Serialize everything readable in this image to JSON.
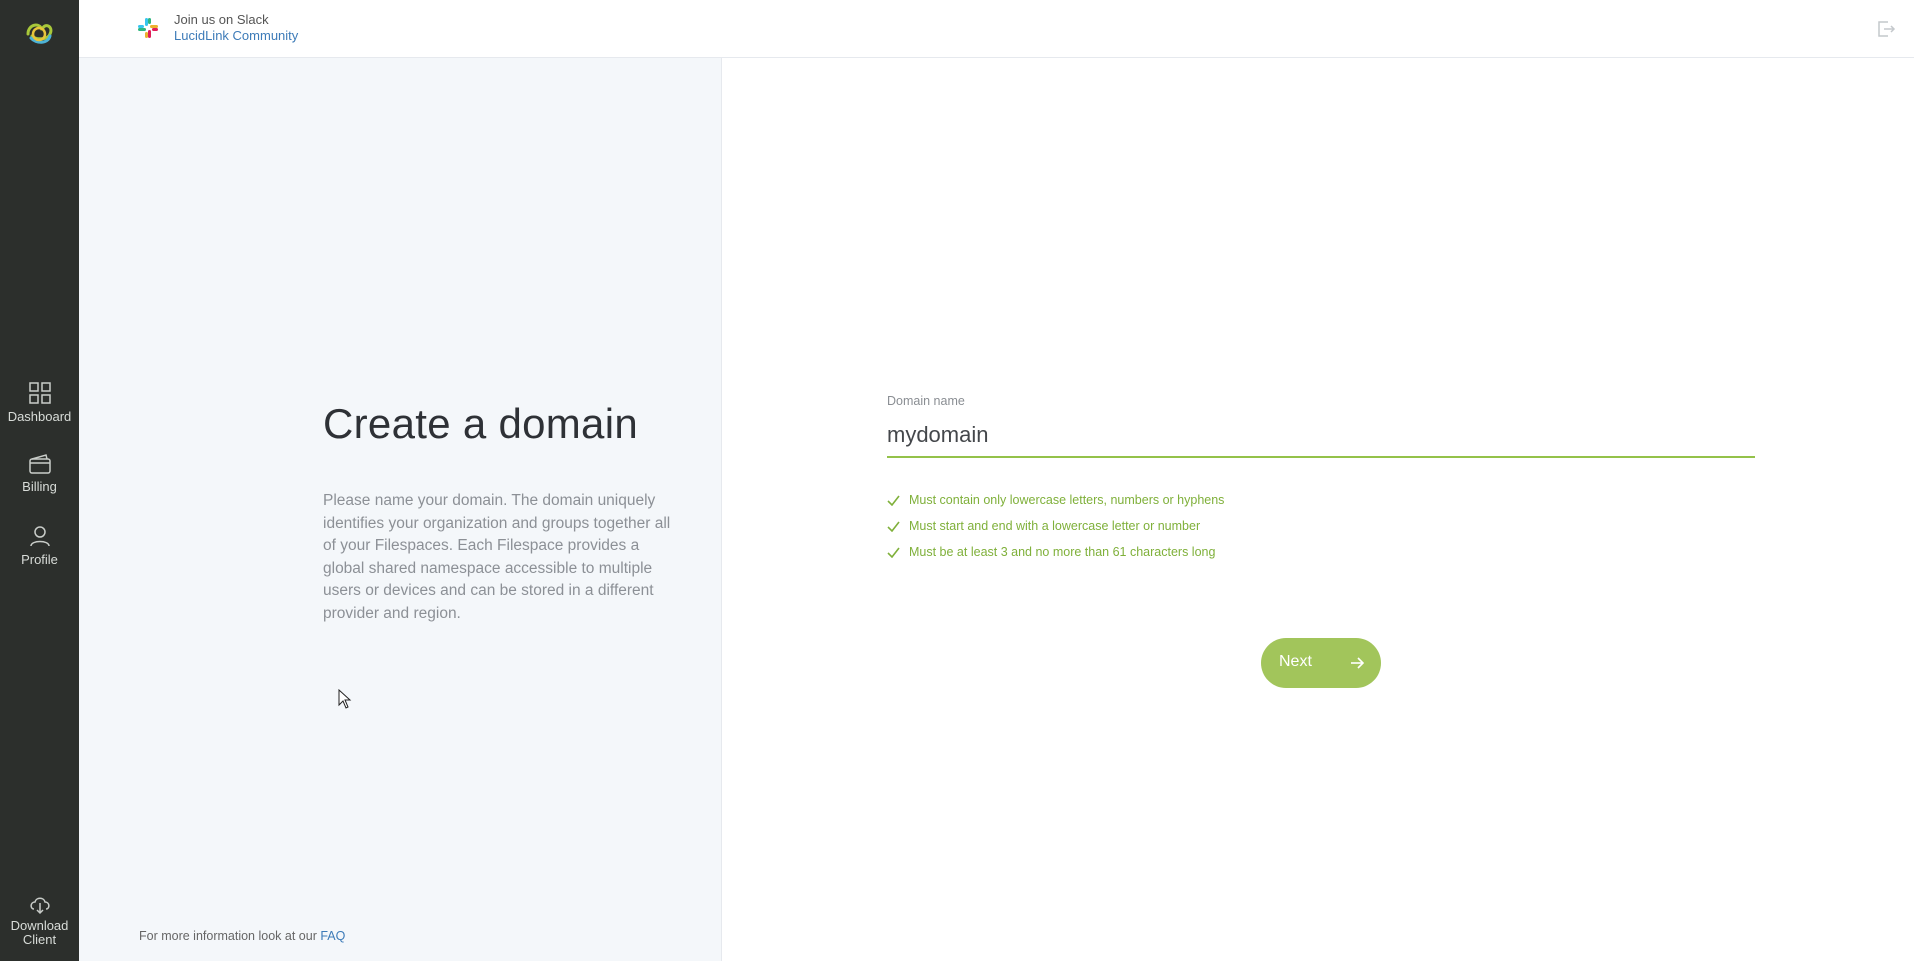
{
  "sidebar": {
    "items": [
      {
        "label": "Dashboard",
        "icon": "grid-icon"
      },
      {
        "label": "Billing",
        "icon": "wallet-icon"
      },
      {
        "label": "Profile",
        "icon": "user-icon"
      }
    ],
    "download": {
      "line1": "Download",
      "line2": "Client",
      "icon": "cloud-download-icon"
    }
  },
  "topbar": {
    "slack_join": "Join us on Slack",
    "slack_link": "LucidLink Community"
  },
  "left": {
    "title": "Create a domain",
    "description": "Please name your domain. The domain uniquely identifies your organization and groups together all of your Filespaces. Each Filespace provides a global shared namespace accessible to multiple users or devices and can be stored in a different provider and region.",
    "faq_prefix": "For more information look at our",
    "faq_link": "FAQ"
  },
  "form": {
    "label": "Domain name",
    "value": "mydomain",
    "rules": [
      "Must contain only lowercase letters, numbers or hyphens",
      "Must start and end with a lowercase letter or number",
      "Must be at least 3 and no more than 61 characters long"
    ],
    "next_label": "Next"
  },
  "colors": {
    "sidebar": "#2c2f2c",
    "accent_green": "#94c24a",
    "button_green": "#a2c55b",
    "link_blue": "#3d7bb8",
    "panel": "#f4f7fa"
  }
}
